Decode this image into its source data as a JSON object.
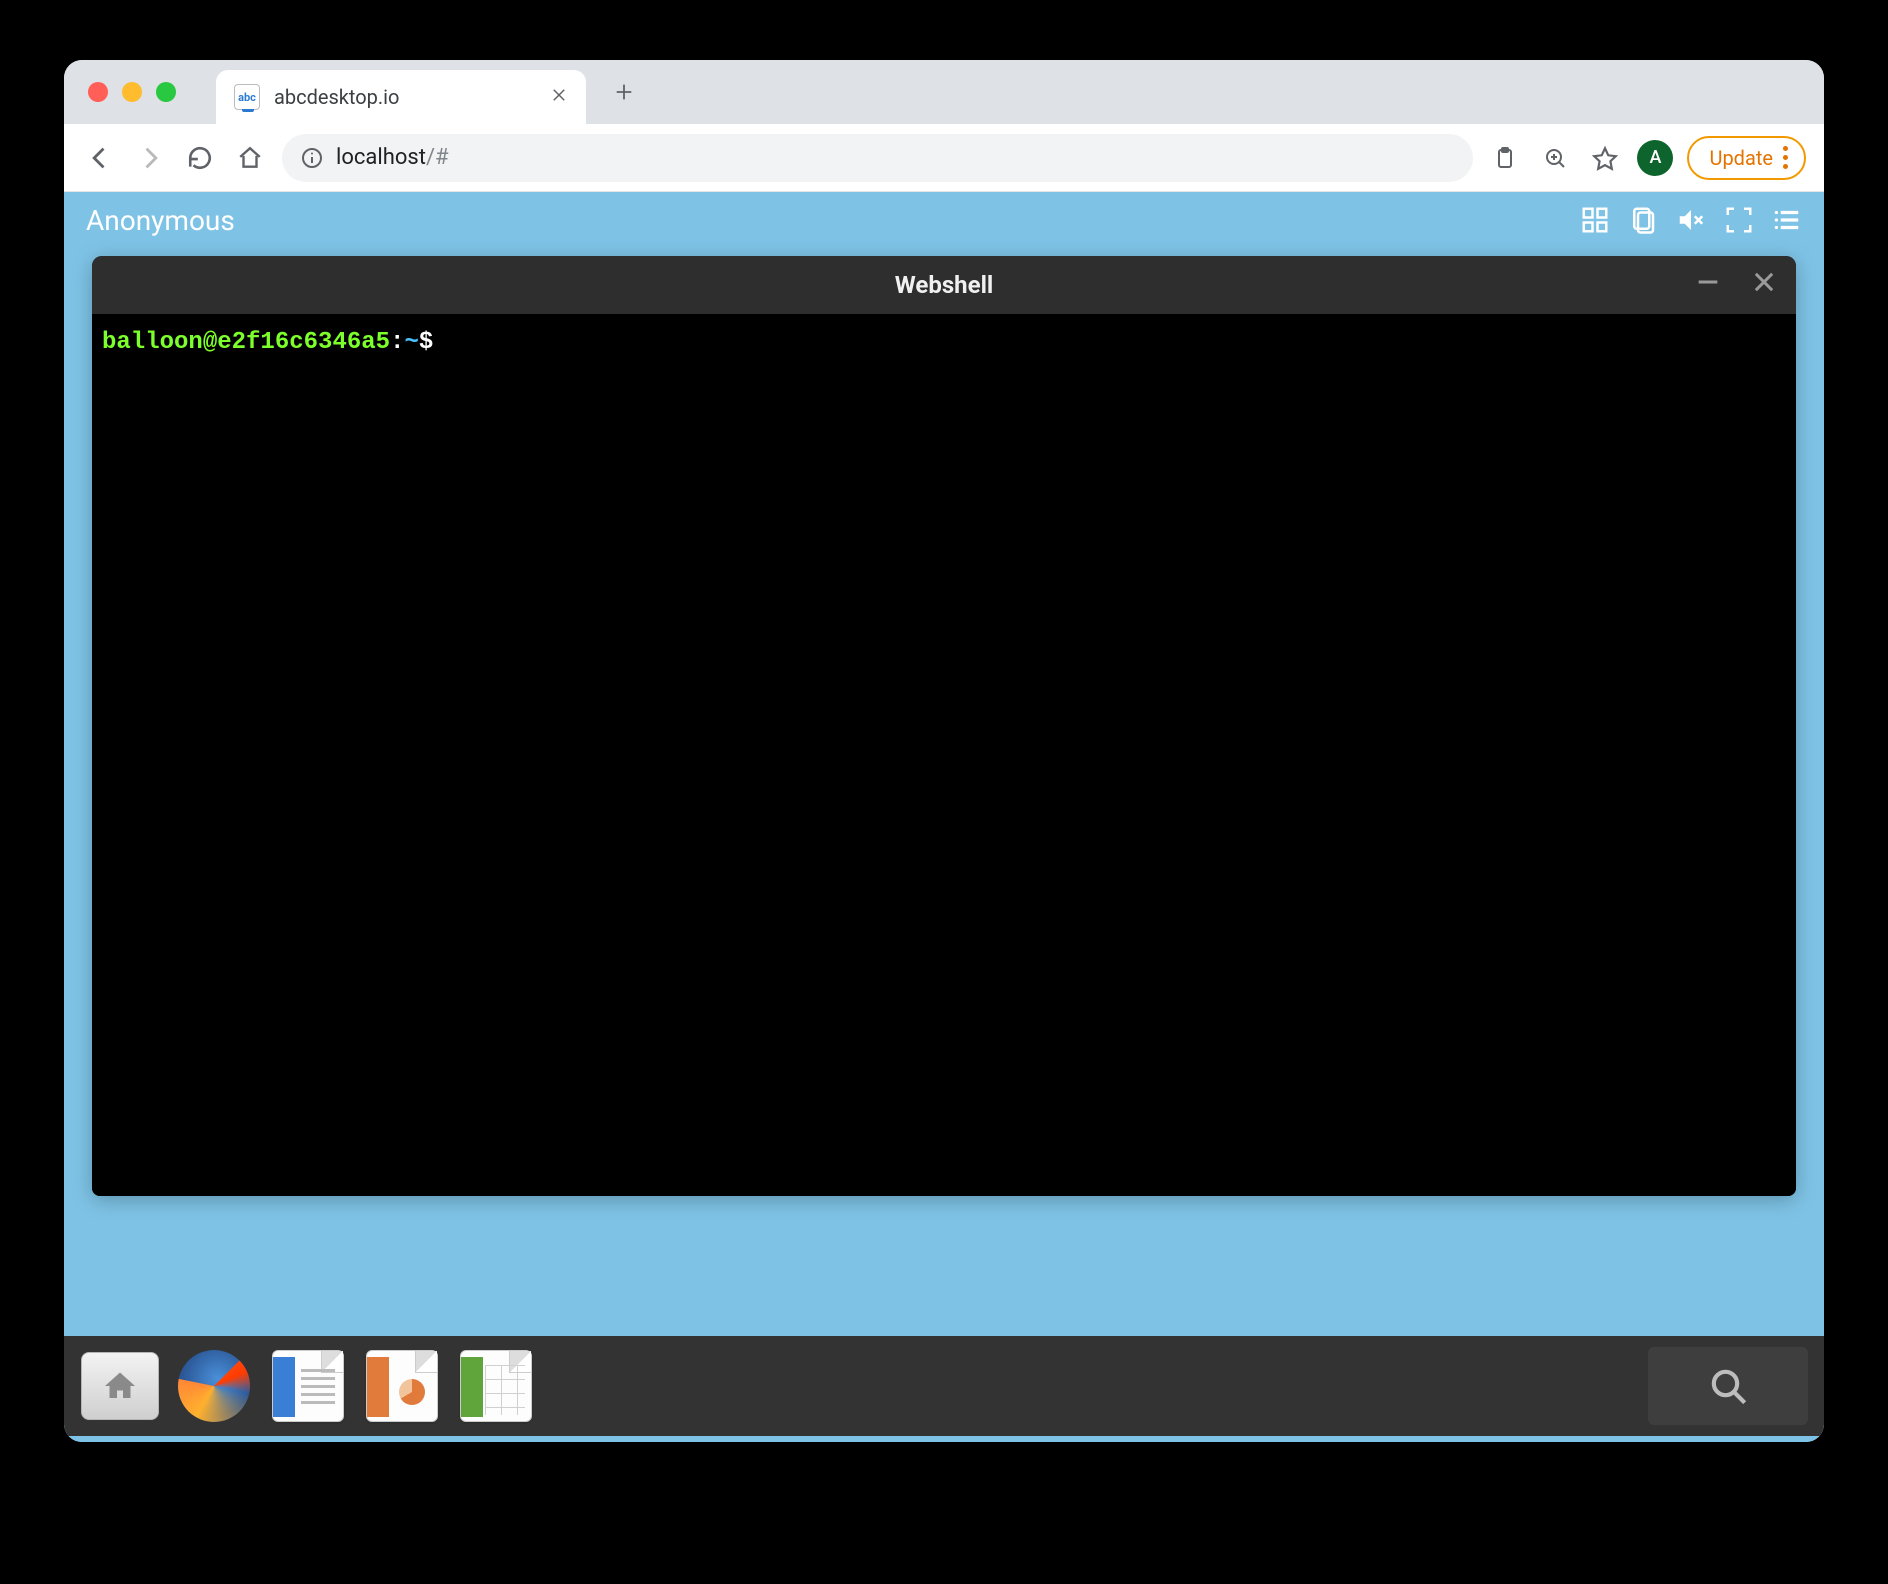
{
  "browser": {
    "tab_title": "abcdesktop.io",
    "url_host": "localhost",
    "url_path": "/#",
    "avatar_initial": "A",
    "update_label": "Update"
  },
  "desktop": {
    "user_label": "Anonymous"
  },
  "shell": {
    "window_title": "Webshell",
    "prompt_userhost": "balloon@e2f16c6346a5",
    "prompt_sep": ":",
    "prompt_path": "~",
    "prompt_symbol": "$"
  },
  "dock": {
    "apps": [
      "files",
      "firefox",
      "writer",
      "impress",
      "calc"
    ]
  }
}
